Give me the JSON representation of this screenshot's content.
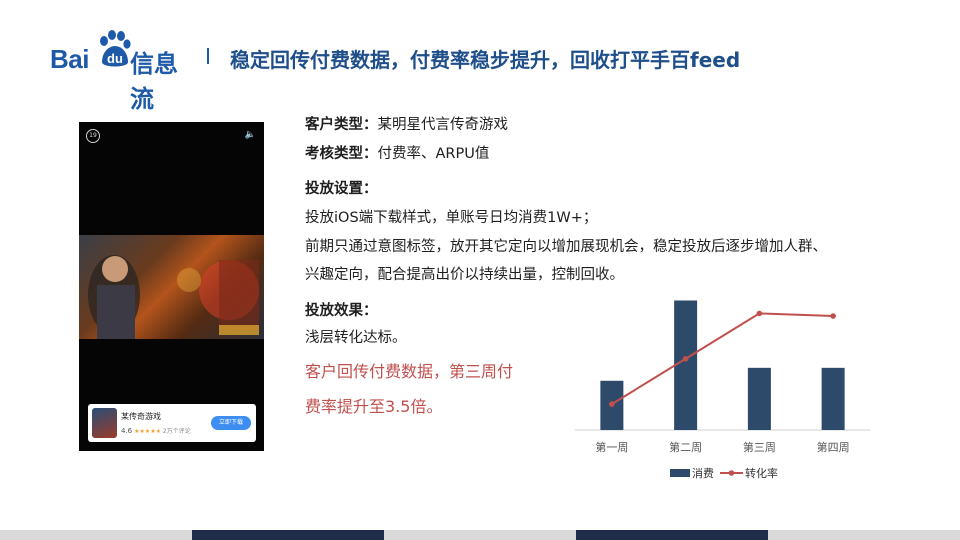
{
  "header": {
    "logo_text": "Baidu",
    "logo_bai": "Bai",
    "logo_du": "du",
    "logo_product": "信息流",
    "title": "稳定回传付费数据，付费率稳步提升，回收打平手百feed"
  },
  "phone": {
    "timer": "19",
    "app_card": {
      "name": "某传奇游戏",
      "rating": "4.6",
      "stars": "★★★★★",
      "reviews": "2万个评论",
      "button": "立即下载"
    }
  },
  "content": {
    "customer_type_label": "客户类型：",
    "customer_type_value": "某明星代言传奇游戏",
    "kpi_label": "考核类型：",
    "kpi_value": "付费率、ARPU值",
    "settings_label": "投放设置：",
    "settings_line1": "投放iOS端下载样式，单账号日均消费1W+；",
    "settings_line2": "前期只通过意图标签，放开其它定向以增加展现机会，稳定投放后逐步增加人群、",
    "settings_line3": "兴趣定向，配合提高出价以持续出量，控制回收。",
    "effect_label": "投放效果：",
    "effect_line1": "浅层转化达标。",
    "highlight_line1": "客户回传付费数据，第三周付",
    "highlight_line2": "费率提升至3.5倍。"
  },
  "chart_data": {
    "type": "bar",
    "categories": [
      "第一周",
      "第二周",
      "第三周",
      "第四周"
    ],
    "series": [
      {
        "name": "消费",
        "type": "bar",
        "values": [
          0.38,
          1.0,
          0.48,
          0.48
        ],
        "color": "#2e4a6b"
      },
      {
        "name": "转化率",
        "type": "line",
        "values": [
          0.2,
          0.55,
          0.9,
          0.88
        ],
        "color": "#c0504d"
      }
    ],
    "ylim": [
      0,
      1.05
    ],
    "grid": false
  },
  "colors": {
    "brand_blue": "#1e5aa8",
    "title_blue": "#1e4f8a",
    "bar_navy": "#2e4a6b",
    "highlight_red": "#c0504d",
    "footer_gray": "#d9d9d9",
    "footer_navy": "#1f2d4a"
  }
}
